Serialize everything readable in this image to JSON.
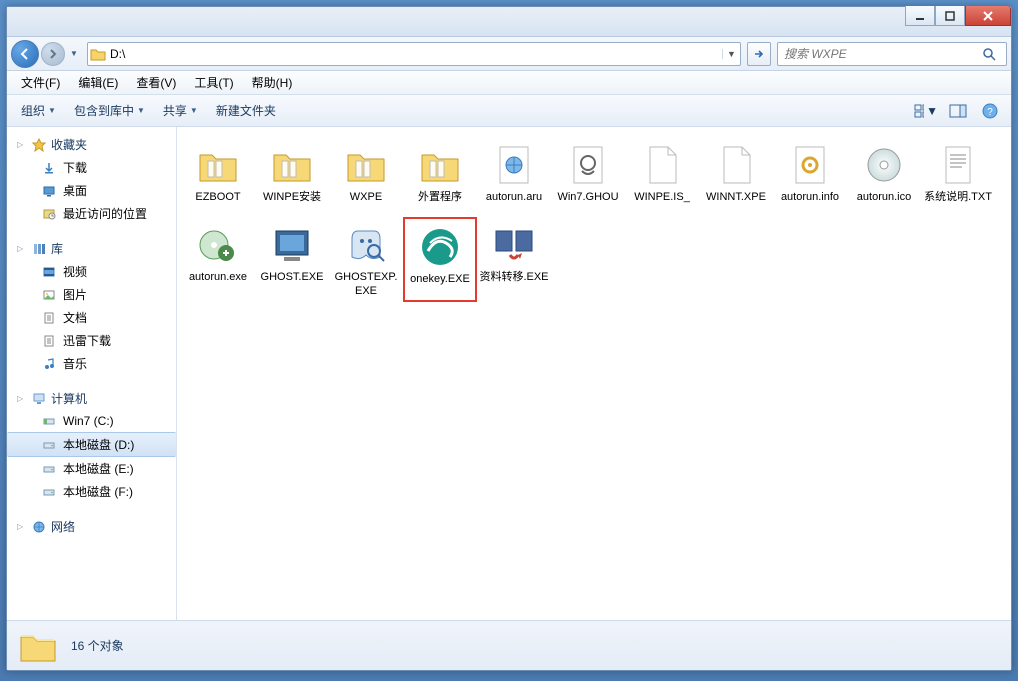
{
  "address_path": "D:\\",
  "search_placeholder": "搜索 WXPE",
  "menus": {
    "file": "文件(F)",
    "edit": "编辑(E)",
    "view": "查看(V)",
    "tools": "工具(T)",
    "help": "帮助(H)"
  },
  "toolbar": {
    "organize": "组织",
    "include": "包含到库中",
    "share": "共享",
    "newfolder": "新建文件夹"
  },
  "sidebar": {
    "favorites": {
      "label": "收藏夹",
      "items": [
        {
          "label": "下载",
          "icon": "download"
        },
        {
          "label": "桌面",
          "icon": "desktop"
        },
        {
          "label": "最近访问的位置",
          "icon": "recent"
        }
      ]
    },
    "libraries": {
      "label": "库",
      "items": [
        {
          "label": "视频",
          "icon": "video"
        },
        {
          "label": "图片",
          "icon": "picture"
        },
        {
          "label": "文档",
          "icon": "doc"
        },
        {
          "label": "迅雷下载",
          "icon": "doc"
        },
        {
          "label": "音乐",
          "icon": "music"
        }
      ]
    },
    "computer": {
      "label": "计算机",
      "items": [
        {
          "label": "Win7 (C:)",
          "icon": "drive-sys"
        },
        {
          "label": "本地磁盘 (D:)",
          "icon": "drive",
          "selected": true
        },
        {
          "label": "本地磁盘 (E:)",
          "icon": "drive"
        },
        {
          "label": "本地磁盘 (F:)",
          "icon": "drive"
        }
      ]
    },
    "network": {
      "label": "网络"
    }
  },
  "files": [
    {
      "name": "EZBOOT",
      "type": "folder"
    },
    {
      "name": "WINPE安装",
      "type": "folder"
    },
    {
      "name": "WXPE",
      "type": "folder"
    },
    {
      "name": "外置程序",
      "type": "folder"
    },
    {
      "name": "autorun.aru",
      "type": "file-web"
    },
    {
      "name": "Win7.GHOU",
      "type": "file-ghost"
    },
    {
      "name": "WINPE.IS_",
      "type": "file-blank"
    },
    {
      "name": "WINNT.XPE",
      "type": "file-blank"
    },
    {
      "name": "autorun.info",
      "type": "file-gear"
    },
    {
      "name": "autorun.ico",
      "type": "file-cd"
    },
    {
      "name": "系统说明.TXT",
      "type": "file-txt"
    },
    {
      "name": "autorun.exe",
      "type": "exe-cd"
    },
    {
      "name": "GHOST.EXE",
      "type": "exe-ghost"
    },
    {
      "name": "GHOSTEXP.EXE",
      "type": "exe-ghostexp"
    },
    {
      "name": "onekey.EXE",
      "type": "exe-onekey",
      "highlight": true
    },
    {
      "name": "资料转移.EXE",
      "type": "exe-transfer"
    }
  ],
  "status": {
    "count_text": "16 个对象"
  }
}
